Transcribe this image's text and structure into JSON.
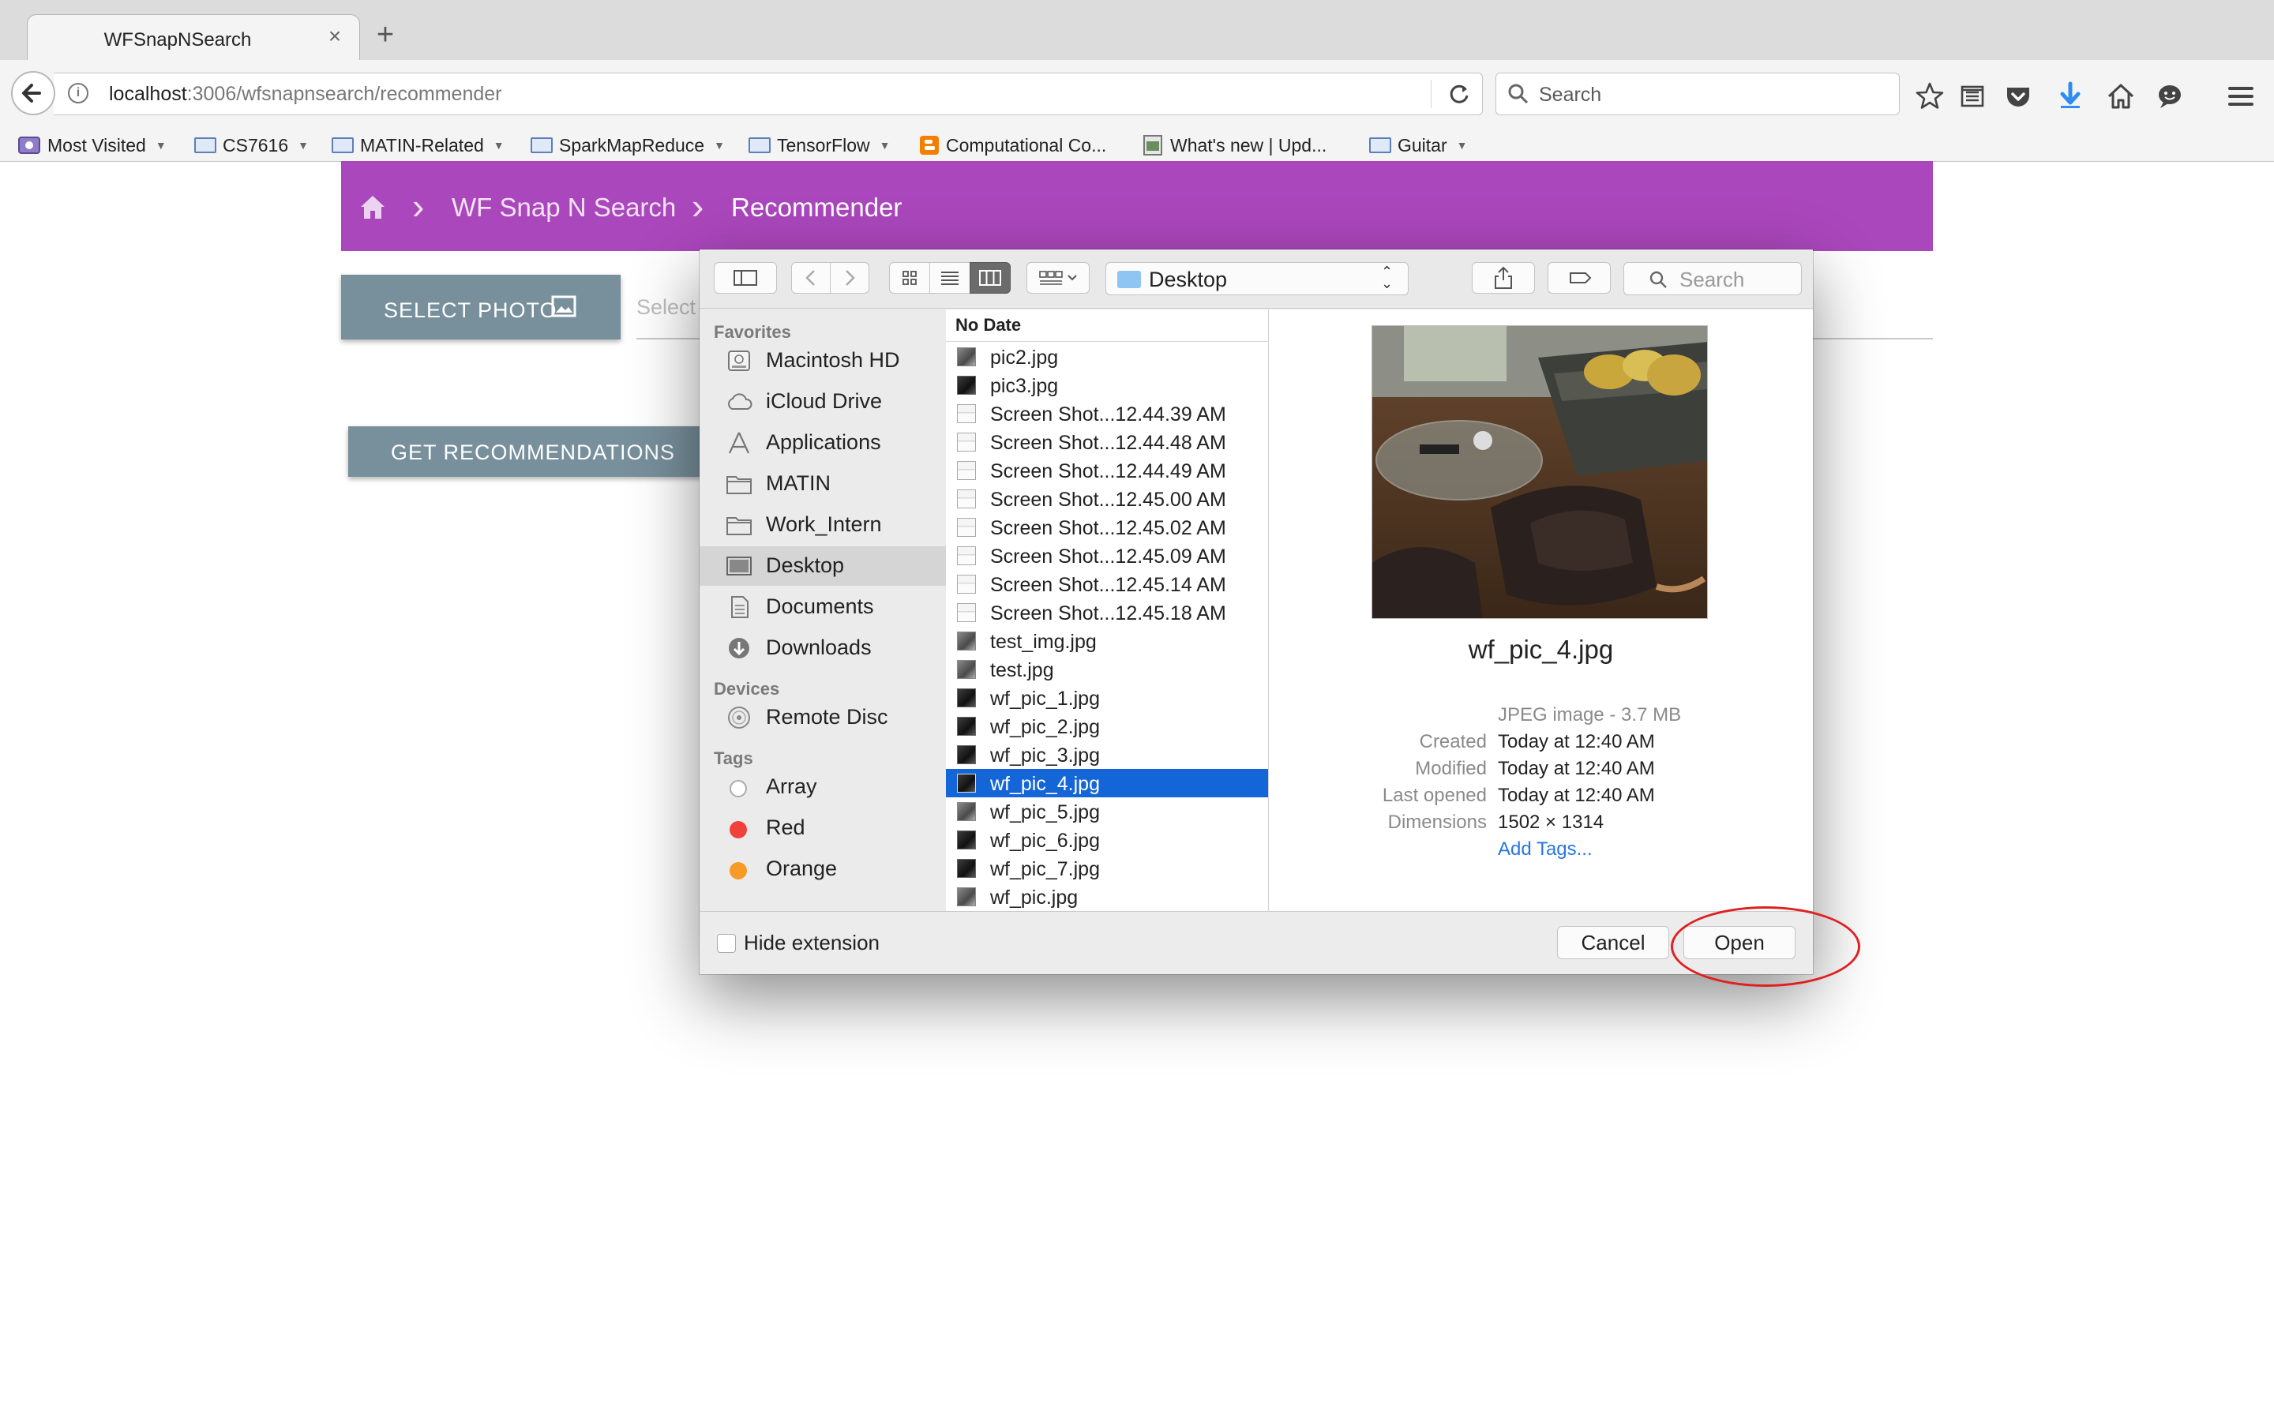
{
  "browser": {
    "tab_title": "WFSnapNSearch",
    "tab_close": "×",
    "new_tab": "+",
    "url_host": "localhost",
    "url_path": ":3006/wfsnapnsearch/recommender",
    "search_placeholder": "Search",
    "bookmarks": [
      {
        "label": "Most Visited",
        "icon": "most-visited-icon",
        "has_menu": true
      },
      {
        "label": "CS7616",
        "icon": "folder-icon",
        "has_menu": true
      },
      {
        "label": "MATIN-Related",
        "icon": "folder-icon",
        "has_menu": true
      },
      {
        "label": "SparkMapReduce",
        "icon": "folder-icon",
        "has_menu": true
      },
      {
        "label": "TensorFlow",
        "icon": "folder-icon",
        "has_menu": true
      },
      {
        "label": "Computational Co...",
        "icon": "blogger-icon",
        "has_menu": false
      },
      {
        "label": "What's new | Upd...",
        "icon": "page-icon",
        "has_menu": false
      },
      {
        "label": "Guitar",
        "icon": "folder-icon",
        "has_menu": true
      }
    ]
  },
  "app": {
    "breadcrumb": [
      "WF Snap N Search",
      "Recommender"
    ],
    "select_photo_label": "SELECT PHOTO",
    "select_placeholder": "Select",
    "get_recommendations_label": "GET RECOMMENDATIONS",
    "accent_color": "#ab47bc",
    "button_color": "#78909c"
  },
  "dialog": {
    "location": "Desktop",
    "search_placeholder": "Search",
    "sidebar": {
      "favorites_header": "Favorites",
      "favorites": [
        {
          "label": "Macintosh HD",
          "icon": "hard-drive-icon"
        },
        {
          "label": "iCloud Drive",
          "icon": "cloud-icon"
        },
        {
          "label": "Applications",
          "icon": "applications-icon"
        },
        {
          "label": "MATIN",
          "icon": "folder-icon"
        },
        {
          "label": "Work_Intern",
          "icon": "folder-icon"
        },
        {
          "label": "Desktop",
          "icon": "desktop-icon",
          "selected": true
        },
        {
          "label": "Documents",
          "icon": "documents-icon"
        },
        {
          "label": "Downloads",
          "icon": "downloads-icon"
        }
      ],
      "devices_header": "Devices",
      "devices": [
        {
          "label": "Remote Disc",
          "icon": "disc-icon"
        }
      ],
      "tags_header": "Tags",
      "tags": [
        {
          "label": "Array",
          "color": "#ffffff"
        },
        {
          "label": "Red",
          "color": "#f0413c"
        },
        {
          "label": "Orange",
          "color": "#f79a26"
        }
      ]
    },
    "column_header": "No Date",
    "files": [
      {
        "name": "pic2.jpg",
        "kind": "photo"
      },
      {
        "name": "pic3.jpg",
        "kind": "photo-dark"
      },
      {
        "name": "Screen Shot...12.44.39 AM",
        "kind": "screenshot"
      },
      {
        "name": "Screen Shot...12.44.48 AM",
        "kind": "screenshot"
      },
      {
        "name": "Screen Shot...12.44.49 AM",
        "kind": "screenshot"
      },
      {
        "name": "Screen Shot...12.45.00 AM",
        "kind": "screenshot"
      },
      {
        "name": "Screen Shot...12.45.02 AM",
        "kind": "screenshot"
      },
      {
        "name": "Screen Shot...12.45.09 AM",
        "kind": "screenshot"
      },
      {
        "name": "Screen Shot...12.45.14 AM",
        "kind": "screenshot"
      },
      {
        "name": "Screen Shot...12.45.18 AM",
        "kind": "screenshot"
      },
      {
        "name": "test_img.jpg",
        "kind": "photo"
      },
      {
        "name": "test.jpg",
        "kind": "photo"
      },
      {
        "name": "wf_pic_1.jpg",
        "kind": "photo-dark"
      },
      {
        "name": "wf_pic_2.jpg",
        "kind": "photo-dark"
      },
      {
        "name": "wf_pic_3.jpg",
        "kind": "photo-dark"
      },
      {
        "name": "wf_pic_4.jpg",
        "kind": "photo-dark",
        "selected": true
      },
      {
        "name": "wf_pic_5.jpg",
        "kind": "photo"
      },
      {
        "name": "wf_pic_6.jpg",
        "kind": "photo-dark"
      },
      {
        "name": "wf_pic_7.jpg",
        "kind": "photo-dark"
      },
      {
        "name": "wf_pic.jpg",
        "kind": "photo"
      }
    ],
    "preview": {
      "name": "wf_pic_4.jpg",
      "kind": "JPEG image - 3.7 MB",
      "meta": [
        {
          "key": "Created",
          "value": "Today at 12:40 AM"
        },
        {
          "key": "Modified",
          "value": "Today at 12:40 AM"
        },
        {
          "key": "Last opened",
          "value": "Today at 12:40 AM"
        },
        {
          "key": "Dimensions",
          "value": "1502 × 1314"
        }
      ],
      "add_tags": "Add Tags..."
    },
    "hide_extension_label": "Hide extension",
    "cancel_label": "Cancel",
    "open_label": "Open"
  }
}
